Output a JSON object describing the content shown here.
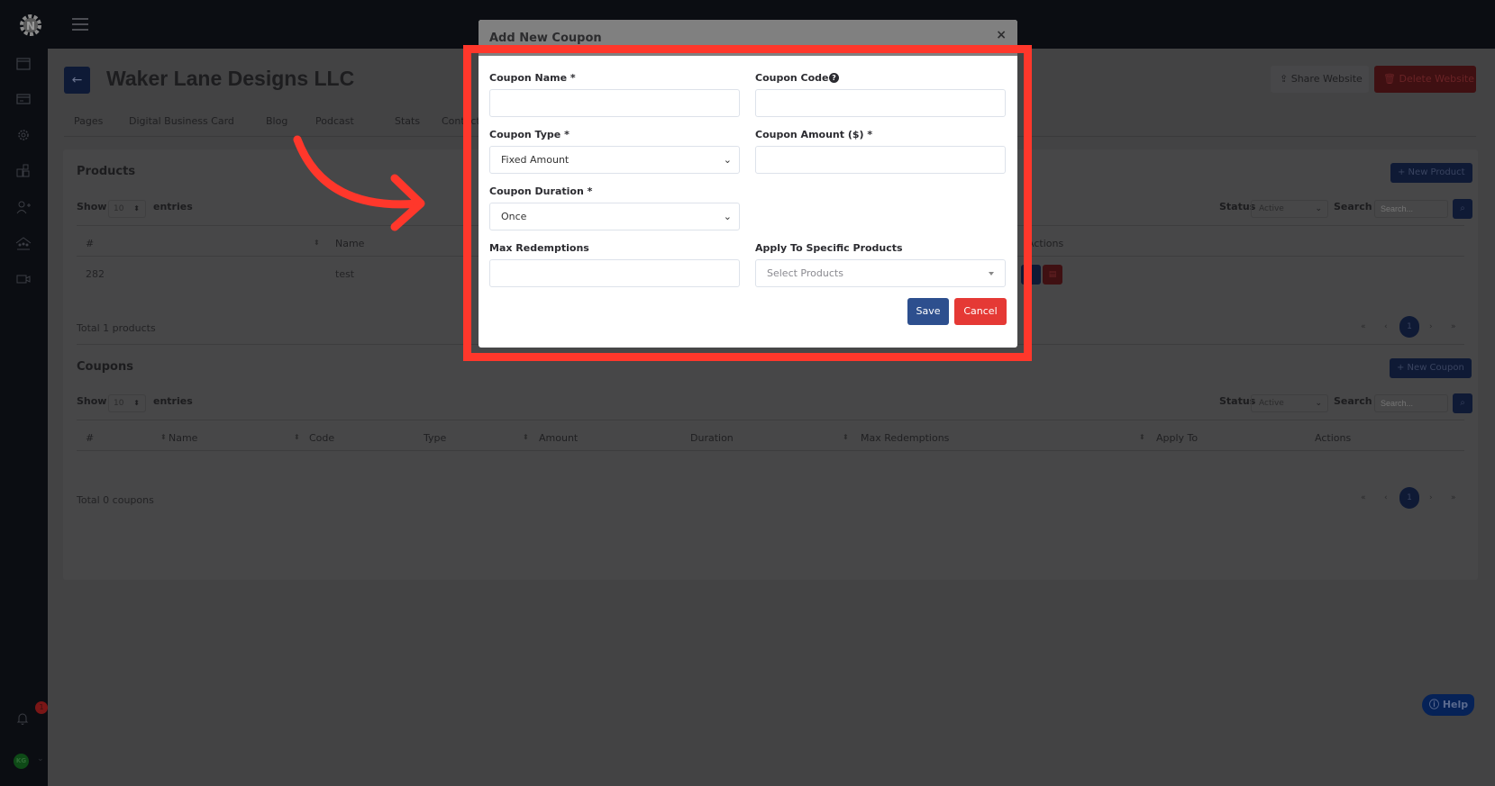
{
  "app": {
    "sidebar_icons": [
      "browser-window-icon",
      "credit-card-icon",
      "gear-icon",
      "puzzle-blocks-icon",
      "add-user-icon",
      "team-icon",
      "video-icon"
    ],
    "notification_count": "1",
    "user_initials": "KG"
  },
  "page": {
    "title": "Waker Lane Designs LLC",
    "share_label": "Share Website",
    "delete_label": "Delete Website",
    "tabs": [
      "Pages",
      "Digital Business Card",
      "Blog",
      "Podcast",
      "Stats",
      "Contacts"
    ]
  },
  "products": {
    "title": "Products",
    "new_label": "+ New Product",
    "show_label": "Show",
    "entries_label": "entries",
    "page_length": "10",
    "status_label": "Status",
    "status_value": "Active",
    "search_label": "Search",
    "search_placeholder": "Search...",
    "columns": [
      "#",
      "Name",
      "Actions"
    ],
    "rows": [
      {
        "id": "282",
        "name": "test"
      }
    ],
    "total": "Total 1 products",
    "pager": {
      "first": "«",
      "prev": "‹",
      "current": "1",
      "next": "›",
      "last": "»"
    }
  },
  "coupons": {
    "title": "Coupons",
    "new_label": "+ New Coupon",
    "show_label": "Show",
    "entries_label": "entries",
    "page_length": "10",
    "status_label": "Status",
    "status_value": "Active",
    "search_label": "Search",
    "search_placeholder": "Search...",
    "columns": [
      "#",
      "Name",
      "Code",
      "Type",
      "Amount",
      "Duration",
      "Max Redemptions",
      "Apply To",
      "Actions"
    ],
    "total": "Total 0 coupons",
    "pager": {
      "first": "«",
      "prev": "‹",
      "current": "1",
      "next": "›",
      "last": "»"
    }
  },
  "help": {
    "label": "Help"
  },
  "modal": {
    "title": "Add New Coupon",
    "close": "×",
    "fields": {
      "name_label": "Coupon Name *",
      "name_value": "",
      "code_label": "Coupon Code",
      "code_value": "",
      "type_label": "Coupon Type *",
      "type_value": "Fixed Amount",
      "amount_label": "Coupon Amount ($) *",
      "amount_value": "",
      "duration_label": "Coupon Duration *",
      "duration_value": "Once",
      "max_label": "Max Redemptions",
      "max_value": "",
      "apply_label": "Apply To Specific Products",
      "apply_placeholder": "Select Products"
    },
    "save_label": "Save",
    "cancel_label": "Cancel"
  },
  "colors": {
    "highlight": "#ff372b",
    "primary": "#2d4f8e",
    "danger": "#e53935"
  }
}
